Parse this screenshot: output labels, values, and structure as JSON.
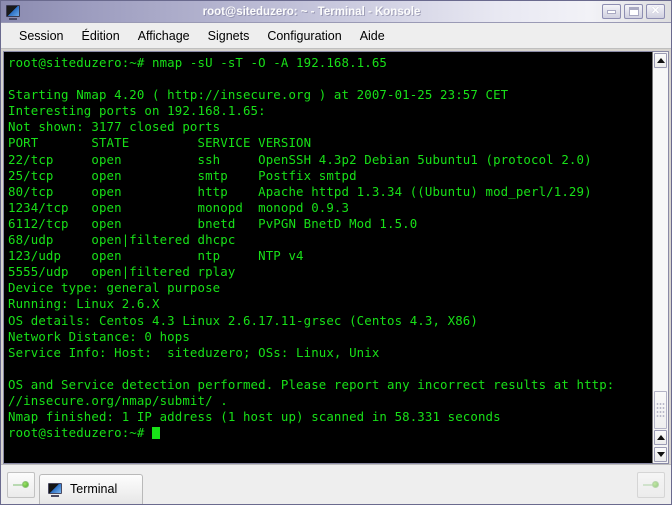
{
  "window": {
    "title": "root@siteduzero: ~ - Terminal - Konsole",
    "icon": "terminal-icon",
    "controls": {
      "minimize": "minimize",
      "maximize": "maximize",
      "close": "close"
    }
  },
  "menubar": {
    "items": [
      {
        "label": "Session"
      },
      {
        "label": "Édition"
      },
      {
        "label": "Affichage"
      },
      {
        "label": "Signets"
      },
      {
        "label": "Configuration"
      },
      {
        "label": "Aide"
      }
    ]
  },
  "terminal": {
    "foreground_color": "#18e018",
    "background_color": "#000000",
    "prompt": "root@siteduzero:~#",
    "lines": [
      "root@siteduzero:~# nmap -sU -sT -O -A 192.168.1.65",
      "",
      "Starting Nmap 4.20 ( http://insecure.org ) at 2007-01-25 23:57 CET",
      "Interesting ports on 192.168.1.65:",
      "Not shown: 3177 closed ports",
      "PORT       STATE         SERVICE VERSION",
      "22/tcp     open          ssh     OpenSSH 4.3p2 Debian 5ubuntu1 (protocol 2.0)",
      "25/tcp     open          smtp    Postfix smtpd",
      "80/tcp     open          http    Apache httpd 1.3.34 ((Ubuntu) mod_perl/1.29)",
      "1234/tcp   open          monopd  monopd 0.9.3",
      "6112/tcp   open          bnetd   PvPGN BnetD Mod 1.5.0",
      "68/udp     open|filtered dhcpc",
      "123/udp    open          ntp     NTP v4",
      "5555/udp   open|filtered rplay",
      "Device type: general purpose",
      "Running: Linux 2.6.X",
      "OS details: Centos 4.3 Linux 2.6.17.11-grsec (Centos 4.3, X86)",
      "Network Distance: 0 hops",
      "Service Info: Host:  siteduzero; OSs: Linux, Unix",
      "",
      "OS and Service detection performed. Please report any incorrect results at http:",
      "//insecure.org/nmap/submit/ .",
      "Nmap finished: 1 IP address (1 host up) scanned in 58.331 seconds"
    ],
    "last_prompt": "root@siteduzero:~# ",
    "cursor": "block-cursor"
  },
  "scrollbar": {
    "up_arrow": "▲",
    "down_arrow": "▼",
    "position": "bottom"
  },
  "tabbar": {
    "new_session_button": "new-session",
    "tabs": [
      {
        "label": "Terminal",
        "icon": "terminal-icon",
        "active": true
      }
    ],
    "right_button": "session-options"
  }
}
